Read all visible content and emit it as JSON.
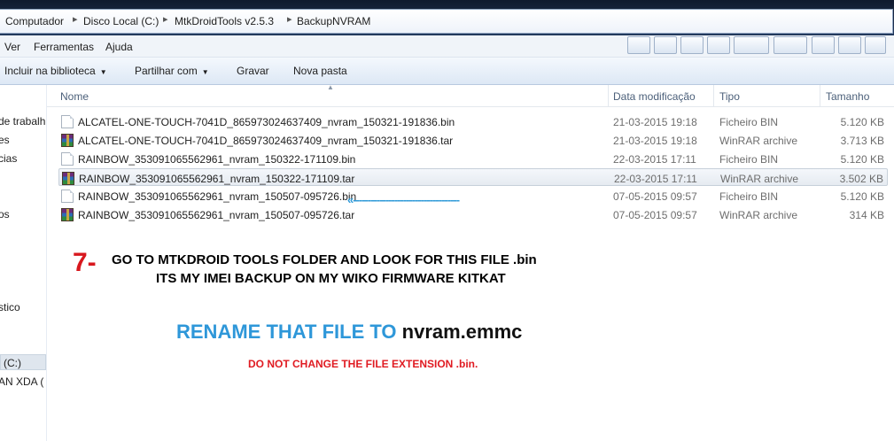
{
  "breadcrumb": [
    "Computador",
    "Disco Local (C:)",
    "MtkDroidTools v2.5.3",
    "BackupNVRAM"
  ],
  "menu": [
    "Ver",
    "Ferramentas",
    "Ajuda"
  ],
  "commands": [
    {
      "label": "Incluir na biblioteca",
      "dropdown": true
    },
    {
      "label": "Partilhar com",
      "dropdown": true
    },
    {
      "label": "Gravar",
      "dropdown": false
    },
    {
      "label": "Nova pasta",
      "dropdown": false
    }
  ],
  "nav_items": [
    "de trabalh",
    "es",
    "cias",
    "os",
    "stico",
    "l (C:)",
    "AN XDA ("
  ],
  "columns": {
    "name": "Nome",
    "date": "Data modificação",
    "type": "Tipo",
    "size": "Tamanho"
  },
  "files": [
    {
      "name": "ALCATEL-ONE-TOUCH-7041D_865973024637409_nvram_150321-191836.bin",
      "date": "21-03-2015 19:18",
      "type": "Ficheiro BIN",
      "size": "5.120 KB",
      "icon": "bin-file-icon"
    },
    {
      "name": "ALCATEL-ONE-TOUCH-7041D_865973024637409_nvram_150321-191836.tar",
      "date": "21-03-2015 19:18",
      "type": "WinRAR archive",
      "size": "3.713 KB",
      "icon": "winrar-archive-icon"
    },
    {
      "name": "RAINBOW_353091065562961_nvram_150322-171109.bin",
      "date": "22-03-2015 17:11",
      "type": "Ficheiro BIN",
      "size": "5.120 KB",
      "icon": "bin-file-icon"
    },
    {
      "name": "RAINBOW_353091065562961_nvram_150322-171109.tar",
      "date": "22-03-2015 17:11",
      "type": "WinRAR archive",
      "size": "3.502 KB",
      "icon": "winrar-archive-icon"
    },
    {
      "name": "RAINBOW_353091065562961_nvram_150507-095726.bin",
      "date": "07-05-2015 09:57",
      "type": "Ficheiro BIN",
      "size": "5.120 KB",
      "icon": "bin-file-icon"
    },
    {
      "name": "RAINBOW_353091065562961_nvram_150507-095726.tar",
      "date": "07-05-2015 09:57",
      "type": "WinRAR archive",
      "size": "314 KB",
      "icon": "winrar-archive-icon"
    }
  ],
  "annotation": {
    "arrow": "«------------------------------------",
    "step": "7-",
    "line1": "GO TO MTKDROID TOOLS FOLDER AND LOOK FOR THIS FILE .bin",
    "line2": "ITS MY IMEI BACKUP ON MY WIKO FIRMWARE KITKAT",
    "rename_prefix": "RENAME THAT FILE TO",
    "rename_target": "nvram.emmc",
    "warning": "DO NOT CHANGE THE FILE EXTENSION .bin."
  },
  "colors": {
    "accent_blue": "#2e97d9",
    "accent_red": "#d8181e",
    "warning_red": "#e01b22"
  }
}
